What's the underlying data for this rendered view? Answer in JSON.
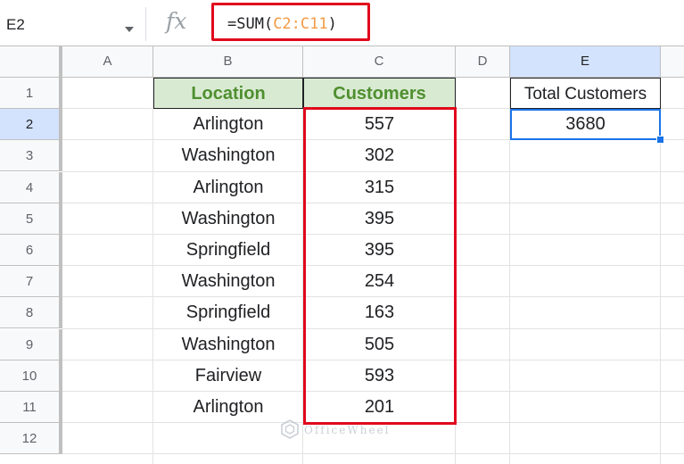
{
  "formula_bar": {
    "name_box": "E2",
    "fx": "fx",
    "formula_prefix": "=SUM(",
    "formula_ref": "C2:C11",
    "formula_suffix": ")"
  },
  "columns": [
    "A",
    "B",
    "C",
    "D",
    "E"
  ],
  "active_column": "E",
  "rows": [
    "1",
    "2",
    "3",
    "4",
    "5",
    "6",
    "7",
    "8",
    "9",
    "10",
    "11",
    "12"
  ],
  "active_row": "2",
  "table": {
    "headers": [
      "Location",
      "Customers"
    ],
    "rows": [
      [
        "Arlington",
        "557"
      ],
      [
        "Washington",
        "302"
      ],
      [
        "Arlington",
        "315"
      ],
      [
        "Washington",
        "395"
      ],
      [
        "Springfield",
        "395"
      ],
      [
        "Washington",
        "254"
      ],
      [
        "Springfield",
        "163"
      ],
      [
        "Washington",
        "505"
      ],
      [
        "Fairview",
        "593"
      ],
      [
        "Arlington",
        "201"
      ]
    ]
  },
  "summary": {
    "label": "Total Customers",
    "value": "3680"
  },
  "watermark": "OfficeWheel",
  "colors": {
    "header_fill": "#d9ead3",
    "header_text": "#4f8f2f",
    "highlight_red": "#e0081c",
    "selection_blue": "#1a73e8",
    "formula_ref": "#f29b45"
  }
}
